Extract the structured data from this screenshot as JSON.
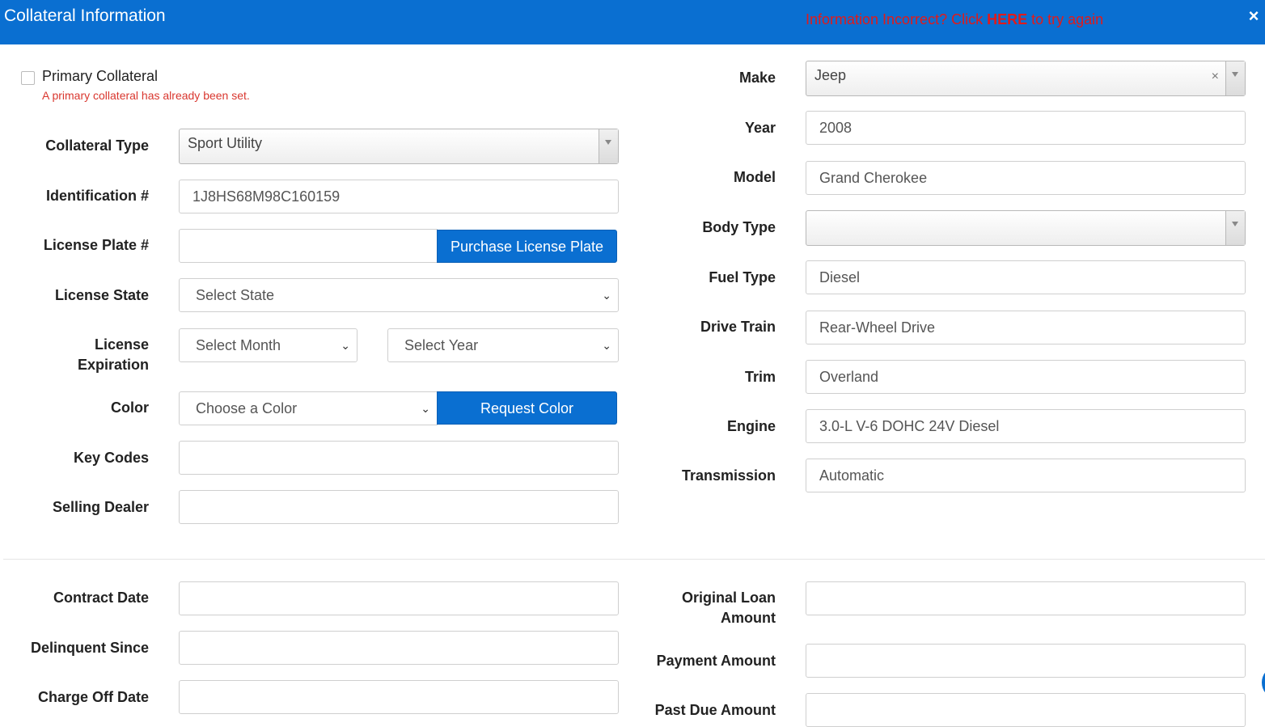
{
  "header": {
    "title": "Collateral Information",
    "notice_prefix": "Information Incorrect? Click ",
    "notice_link": "HERE",
    "notice_suffix": " to try again",
    "close_icon": "×"
  },
  "primary": {
    "label": "Primary Collateral",
    "checked": false,
    "warning": "A primary collateral has already been set."
  },
  "left_fields": {
    "collateral_type": {
      "label": "Collateral Type",
      "value": "Sport Utility"
    },
    "identification": {
      "label": "Identification #",
      "value": "1J8HS68M98C160159"
    },
    "license_plate": {
      "label": "License Plate #",
      "value": "",
      "button": "Purchase License Plate"
    },
    "license_state": {
      "label": "License State",
      "value": "Select State"
    },
    "license_expiration": {
      "label_line1": "License",
      "label_line2": "Expiration",
      "month": "Select Month",
      "year": "Select Year"
    },
    "color": {
      "label": "Color",
      "value": "Choose a Color",
      "button": "Request Color"
    },
    "key_codes": {
      "label": "Key Codes",
      "value": ""
    },
    "selling_dealer": {
      "label": "Selling Dealer",
      "value": ""
    }
  },
  "right_fields": {
    "make": {
      "label": "Make",
      "value": "Jeep",
      "clear_icon": "×"
    },
    "year": {
      "label": "Year",
      "value": "2008"
    },
    "model": {
      "label": "Model",
      "value": "Grand Cherokee"
    },
    "body_type": {
      "label": "Body Type",
      "value": ""
    },
    "fuel_type": {
      "label": "Fuel Type",
      "value": "Diesel"
    },
    "drive_train": {
      "label": "Drive Train",
      "value": "Rear-Wheel Drive"
    },
    "trim": {
      "label": "Trim",
      "value": "Overland"
    },
    "engine": {
      "label": "Engine",
      "value": "3.0-L V-6 DOHC 24V Diesel"
    },
    "transmission": {
      "label": "Transmission",
      "value": "Automatic"
    }
  },
  "loan_left": {
    "contract_date": {
      "label": "Contract Date",
      "value": ""
    },
    "delinquent_since": {
      "label": "Delinquent Since",
      "value": ""
    },
    "charge_off_date": {
      "label": "Charge Off Date",
      "value": ""
    }
  },
  "loan_right": {
    "original_loan_amount": {
      "label_line1": "Original Loan",
      "label_line2": "Amount",
      "value": ""
    },
    "payment_amount": {
      "label": "Payment Amount",
      "value": ""
    },
    "past_due_amount": {
      "label": "Past Due Amount",
      "value": ""
    }
  },
  "icons": {
    "dropdown": "chevron-down-icon",
    "close": "close-icon"
  },
  "colors": {
    "primary": "#0a6fd1",
    "warning": "#d9372f",
    "notice": "#e21a1a"
  }
}
